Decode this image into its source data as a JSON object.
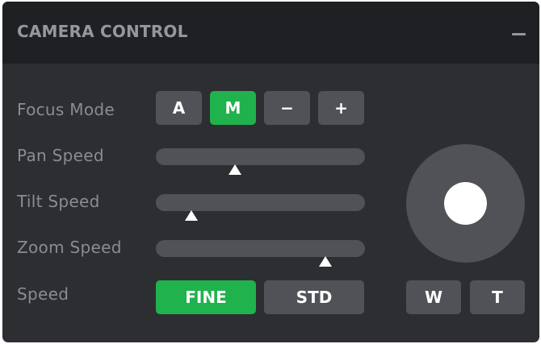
{
  "panel": {
    "title": "CAMERA CONTROL",
    "collapse_icon": "minus-icon"
  },
  "focus_mode": {
    "label": "Focus Mode",
    "buttons": [
      {
        "label": "A",
        "active": false
      },
      {
        "label": "M",
        "active": true
      },
      {
        "label": "−",
        "active": false
      },
      {
        "label": "+",
        "active": false
      }
    ]
  },
  "sliders": {
    "pan": {
      "label": "Pan Speed",
      "value": 0.38
    },
    "tilt": {
      "label": "Tilt Speed",
      "value": 0.17
    },
    "zoom": {
      "label": "Zoom Speed",
      "value": 0.81
    }
  },
  "speed": {
    "label": "Speed",
    "buttons": [
      {
        "label": "FINE",
        "active": true
      },
      {
        "label": "STD",
        "active": false
      }
    ]
  },
  "zoom_buttons": {
    "wide": "W",
    "tele": "T"
  },
  "colors": {
    "accent": "#20b24d",
    "panel": "#2d2e31",
    "header": "#1f2023",
    "control": "#505257"
  }
}
